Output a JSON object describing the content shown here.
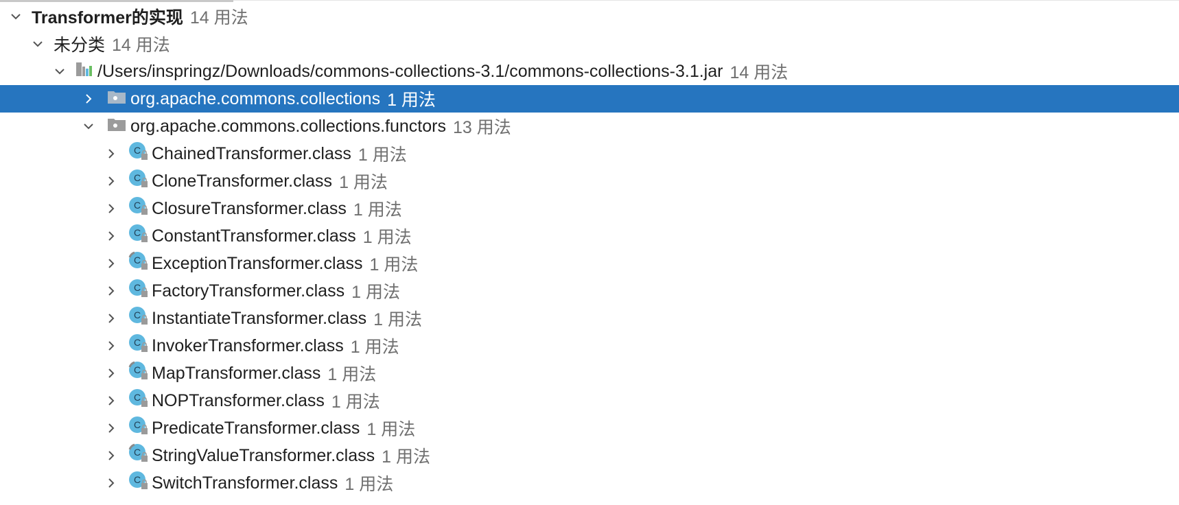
{
  "tree": {
    "root": {
      "label": "Transformer的实现",
      "count": "14 用法",
      "expanded": true
    },
    "category": {
      "label": "未分类",
      "count": "14 用法",
      "expanded": true
    },
    "jar": {
      "label": "/Users/inspringz/Downloads/commons-collections-3.1/commons-collections-3.1.jar",
      "count": "14 用法",
      "expanded": true,
      "icon": "jar-library-icon"
    },
    "packages": [
      {
        "label": "org.apache.commons.collections",
        "count": "1 用法",
        "expanded": false,
        "selected": true,
        "icon": "package-icon"
      },
      {
        "label": "org.apache.commons.collections.functors",
        "count": "13 用法",
        "expanded": true,
        "selected": false,
        "icon": "package-icon"
      }
    ],
    "classes": [
      {
        "label": "ChainedTransformer.class",
        "count": "1 用法",
        "icon": "class-icon"
      },
      {
        "label": "CloneTransformer.class",
        "count": "1 用法",
        "icon": "class-icon"
      },
      {
        "label": "ClosureTransformer.class",
        "count": "1 用法",
        "icon": "class-icon"
      },
      {
        "label": "ConstantTransformer.class",
        "count": "1 用法",
        "icon": "class-icon"
      },
      {
        "label": "ExceptionTransformer.class",
        "count": "1 用法",
        "icon": "class-pinned-icon"
      },
      {
        "label": "FactoryTransformer.class",
        "count": "1 用法",
        "icon": "class-icon"
      },
      {
        "label": "InstantiateTransformer.class",
        "count": "1 用法",
        "icon": "class-icon"
      },
      {
        "label": "InvokerTransformer.class",
        "count": "1 用法",
        "icon": "class-icon"
      },
      {
        "label": "MapTransformer.class",
        "count": "1 用法",
        "icon": "class-pinned-icon"
      },
      {
        "label": "NOPTransformer.class",
        "count": "1 用法",
        "icon": "class-icon"
      },
      {
        "label": "PredicateTransformer.class",
        "count": "1 用法",
        "icon": "class-icon"
      },
      {
        "label": "StringValueTransformer.class",
        "count": "1 用法",
        "icon": "class-pinned-icon"
      },
      {
        "label": "SwitchTransformer.class",
        "count": "1 用法",
        "icon": "class-icon"
      }
    ]
  },
  "colors": {
    "selection": "#2675bf",
    "count_text": "#6f6f6f",
    "class_icon": "#5fb8df",
    "package_icon": "#9b9b9b"
  }
}
